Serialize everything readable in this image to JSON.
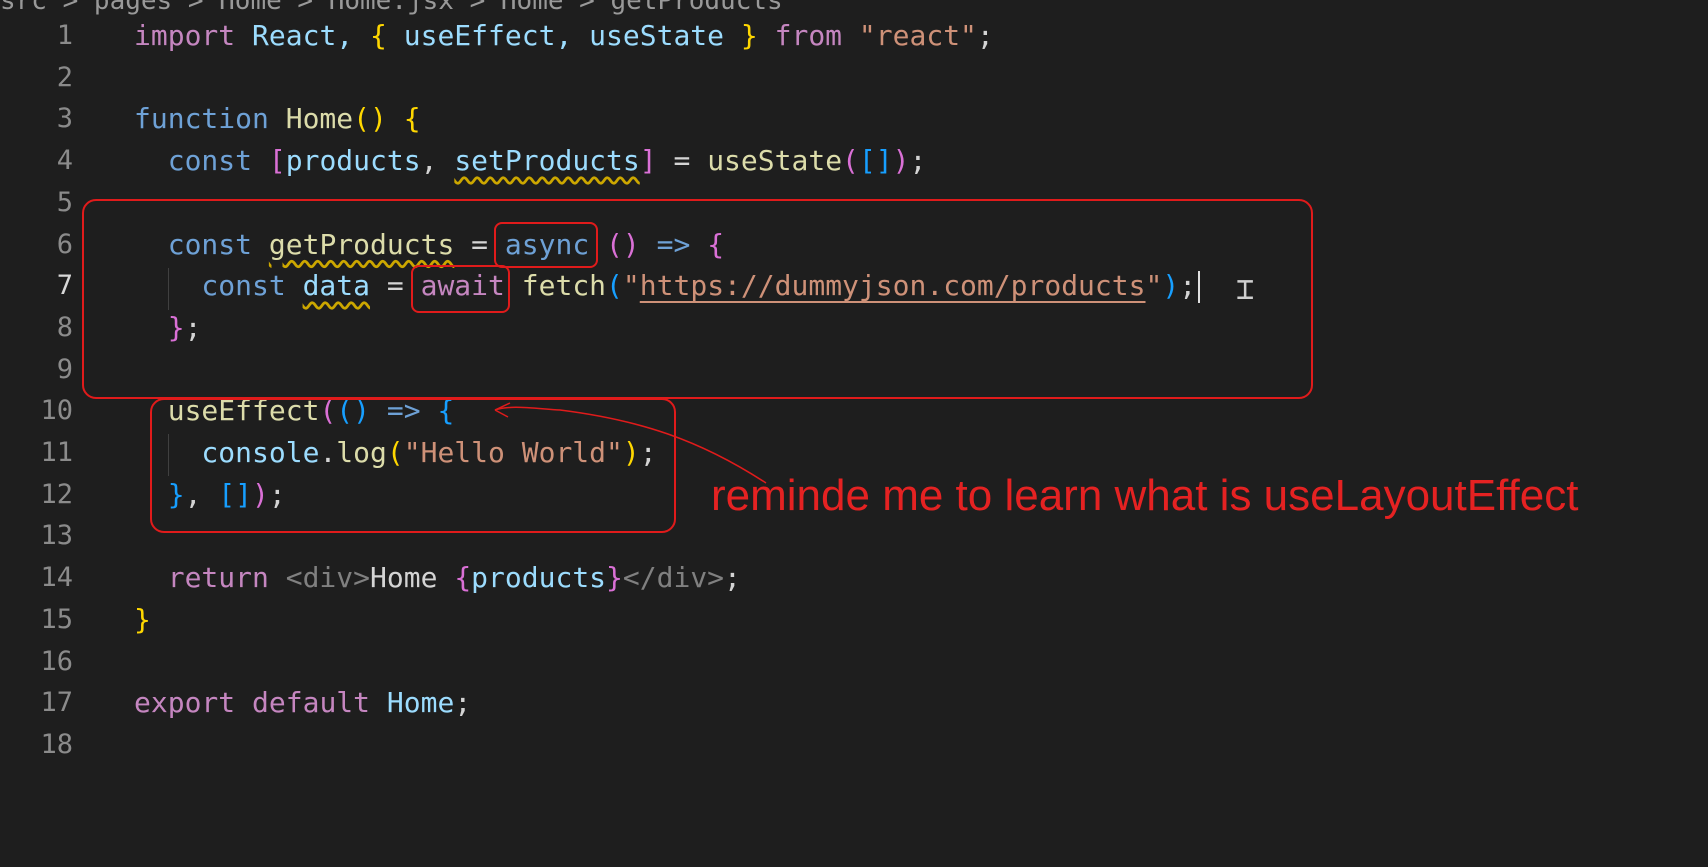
{
  "breadcrumb": "src > pages > Home > Home.jsx > Home > getProducts",
  "lines": [
    {
      "n": "1",
      "tokens": [
        [
          "import",
          "kw2"
        ],
        [
          " React, ",
          "var"
        ],
        [
          "{",
          "br1"
        ],
        [
          " useEffect, useState ",
          "var"
        ],
        [
          "}",
          "br1"
        ],
        [
          " from ",
          "kw2"
        ],
        [
          "\"react\"",
          "str"
        ],
        [
          ";",
          "plain"
        ]
      ]
    },
    {
      "n": "2",
      "tokens": []
    },
    {
      "n": "3",
      "tokens": [
        [
          "function",
          "kw"
        ],
        [
          " ",
          "plain"
        ],
        [
          "Home",
          "fn"
        ],
        [
          "()",
          "br1"
        ],
        [
          " ",
          "plain"
        ],
        [
          "{",
          "br1"
        ]
      ]
    },
    {
      "n": "4",
      "tokens": [
        [
          "  const",
          "kw"
        ],
        [
          " ",
          "plain"
        ],
        [
          "[",
          "br2"
        ],
        [
          "products",
          "var"
        ],
        [
          ", ",
          "plain"
        ],
        [
          "setProducts",
          "var",
          "sq"
        ],
        [
          "]",
          "br2"
        ],
        [
          " = ",
          "plain"
        ],
        [
          "useState",
          "fn"
        ],
        [
          "(",
          "br2"
        ],
        [
          "[]",
          "br3"
        ],
        [
          ")",
          "br2"
        ],
        [
          ";",
          "plain"
        ]
      ]
    },
    {
      "n": "5",
      "tokens": []
    },
    {
      "n": "6",
      "tokens": [
        [
          "  const",
          "kw"
        ],
        [
          " ",
          "plain"
        ],
        [
          "getProducts",
          "fn",
          "sq"
        ],
        [
          " = ",
          "plain"
        ],
        [
          "async",
          "kw"
        ],
        [
          " ",
          "plain"
        ],
        [
          "()",
          "br2"
        ],
        [
          " => ",
          "kw"
        ],
        [
          "{",
          "br2"
        ]
      ]
    },
    {
      "n": "7",
      "tokens": [
        [
          "    const",
          "kw"
        ],
        [
          " ",
          "plain"
        ],
        [
          "data",
          "var",
          "sq"
        ],
        [
          " = ",
          "plain"
        ],
        [
          "await",
          "kw2"
        ],
        [
          " ",
          "plain"
        ],
        [
          "fetch",
          "fn"
        ],
        [
          "(",
          "br3"
        ],
        [
          "\"",
          "str"
        ],
        [
          "https://dummyjson.com/products",
          "str",
          "ul"
        ],
        [
          "\"",
          "str"
        ],
        [
          ")",
          "br3"
        ],
        [
          ";",
          "plain"
        ]
      ]
    },
    {
      "n": "8",
      "tokens": [
        [
          "  ",
          "plain"
        ],
        [
          "}",
          "br2"
        ],
        [
          ";",
          "plain"
        ]
      ]
    },
    {
      "n": "9",
      "tokens": []
    },
    {
      "n": "10",
      "tokens": [
        [
          "  ",
          "plain"
        ],
        [
          "useEffect",
          "fn"
        ],
        [
          "(",
          "br2"
        ],
        [
          "()",
          "br3"
        ],
        [
          " => ",
          "kw"
        ],
        [
          "{",
          "br3"
        ]
      ]
    },
    {
      "n": "11",
      "tokens": [
        [
          "    console",
          "var"
        ],
        [
          ".",
          "plain"
        ],
        [
          "log",
          "fn"
        ],
        [
          "(",
          "br1"
        ],
        [
          "\"Hello World\"",
          "str"
        ],
        [
          ")",
          "br1"
        ],
        [
          ";",
          "plain"
        ]
      ]
    },
    {
      "n": "12",
      "tokens": [
        [
          "  ",
          "plain"
        ],
        [
          "}",
          "br3"
        ],
        [
          ", ",
          "plain"
        ],
        [
          "[]",
          "br3"
        ],
        [
          ")",
          "br2"
        ],
        [
          ";",
          "plain"
        ]
      ]
    },
    {
      "n": "13",
      "tokens": []
    },
    {
      "n": "14",
      "tokens": [
        [
          "  return",
          "kw2"
        ],
        [
          " ",
          "plain"
        ],
        [
          "<div>",
          "tag"
        ],
        [
          "Home ",
          "plain"
        ],
        [
          "{",
          "br2"
        ],
        [
          "products",
          "var"
        ],
        [
          "}",
          "br2"
        ],
        [
          "</div>",
          "tag"
        ],
        [
          ";",
          "plain"
        ]
      ]
    },
    {
      "n": "15",
      "tokens": [
        [
          "}",
          "br1"
        ]
      ]
    },
    {
      "n": "16",
      "tokens": []
    },
    {
      "n": "17",
      "tokens": [
        [
          "export",
          "kw2"
        ],
        [
          " ",
          "plain"
        ],
        [
          "default",
          "kw2"
        ],
        [
          " ",
          "plain"
        ],
        [
          "Home",
          "var"
        ],
        [
          ";",
          "plain"
        ]
      ]
    },
    {
      "n": "18",
      "tokens": []
    }
  ],
  "annotation": {
    "note": "reminde me to learn what is useLayoutEffect",
    "color": "#e01b1b"
  },
  "colors": {
    "background": "#1e1e1e",
    "keyword": "#6ea1d6",
    "control_keyword": "#c586c0",
    "function": "#dcdcaa",
    "variable": "#9cdcfe",
    "string": "#ce9178"
  }
}
